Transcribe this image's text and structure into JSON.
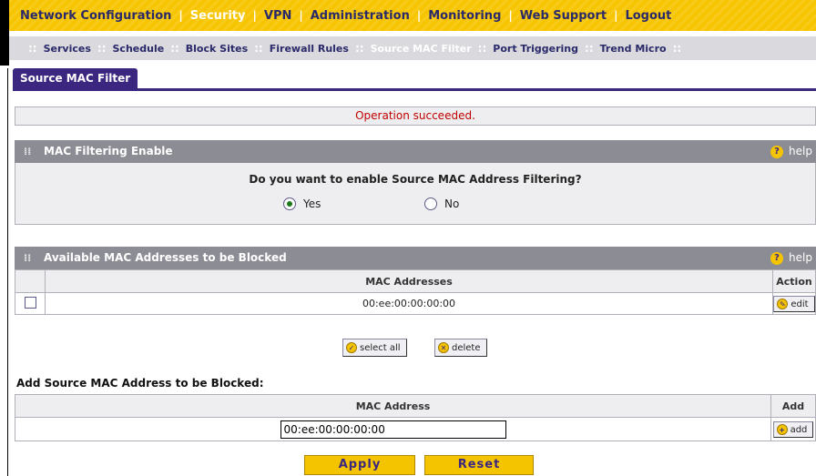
{
  "top_nav": {
    "items": [
      {
        "label": "Network Configuration",
        "active": false
      },
      {
        "label": "Security",
        "active": true
      },
      {
        "label": "VPN",
        "active": false
      },
      {
        "label": "Administration",
        "active": false
      },
      {
        "label": "Monitoring",
        "active": false
      },
      {
        "label": "Web Support",
        "active": false
      },
      {
        "label": "Logout",
        "active": false
      }
    ]
  },
  "sub_nav": {
    "items": [
      {
        "label": "Services",
        "active": false
      },
      {
        "label": "Schedule",
        "active": false
      },
      {
        "label": "Block Sites",
        "active": false
      },
      {
        "label": "Firewall Rules",
        "active": false
      },
      {
        "label": "Source MAC Filter",
        "active": true
      },
      {
        "label": "Port Triggering",
        "active": false
      },
      {
        "label": "Trend Micro",
        "active": false
      }
    ]
  },
  "tab": {
    "label": "Source MAC Filter"
  },
  "status": {
    "message": "Operation succeeded."
  },
  "mac_filter_enable": {
    "title": "MAC Filtering Enable",
    "help_label": "help",
    "question": "Do you want to enable Source MAC Address Filtering?",
    "options": [
      {
        "label": "Yes",
        "selected": true
      },
      {
        "label": "No",
        "selected": false
      }
    ]
  },
  "available_macs": {
    "title": "Available MAC Addresses to be Blocked",
    "help_label": "help",
    "columns": {
      "mac": "MAC Addresses",
      "action": "Action"
    },
    "rows": [
      {
        "mac": "00:ee:00:00:00:00",
        "action_label": "edit"
      }
    ],
    "select_all_label": "select all",
    "delete_label": "delete"
  },
  "add_mac": {
    "title": "Add Source MAC Address to be Blocked:",
    "columns": {
      "mac": "MAC Address",
      "add": "Add"
    },
    "input_value": "00:ee:00:00:00:00",
    "add_label": "add"
  },
  "buttons": {
    "apply": "Apply",
    "reset": "Reset"
  },
  "colors": {
    "nav_yellow": "#f7c400",
    "tab_purple": "#3b2680",
    "status_red": "#c00000",
    "section_gray": "#8c8c94"
  }
}
